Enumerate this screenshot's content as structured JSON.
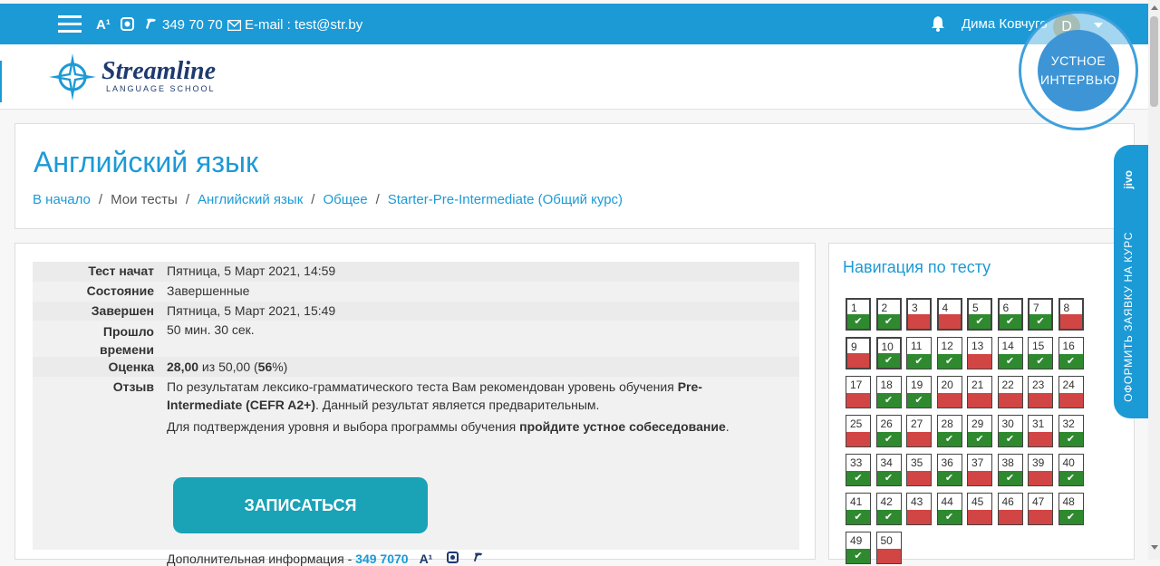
{
  "topbar": {
    "phone": "349 70 70",
    "email": "E-mail : test@str.by",
    "username": "Дима Ковчуго",
    "avatar_letter": "D",
    "icon_a1": "A¹"
  },
  "header": {
    "logo_name": "Streamline",
    "logo_sub": "LANGUAGE SCHOOL",
    "interview_line1": "УСТНОЕ",
    "interview_line2": "ИНТЕРВЬЮ"
  },
  "page": {
    "title": "Английский язык",
    "breadcrumb": [
      "В начало",
      "Мои тесты",
      "Английский язык",
      "Общее",
      "Starter-Pre-Intermediate (Общий курс)"
    ]
  },
  "summary": {
    "started_label": "Тест начат",
    "started_value": "Пятница, 5 Март 2021, 14:59",
    "state_label": "Состояние",
    "state_value": "Завершенные",
    "finished_label": "Завершен",
    "finished_value": "Пятница, 5 Март 2021, 15:49",
    "elapsed_label_1": "Прошло",
    "elapsed_label_2": "времени",
    "elapsed_value": "50 мин. 30 сек.",
    "grade_label": "Оценка",
    "grade_score": "28,00",
    "grade_mid": " из 50,00 (",
    "grade_pct": "56",
    "grade_end": "%)",
    "feedback_label": "Отзыв",
    "feedback_text_1": "По результатам лексико-грамматического теста Вам рекомендован уровень обучения ",
    "feedback_bold": "Pre-Intermediate (CEFR A2+)",
    "feedback_text_2": ". Данный результат является предварительным.",
    "confirm_text": "Для подтверждения уровня и выбора программы обучения ",
    "confirm_bold": "пройдите устное собеседование",
    "confirm_end": ".",
    "enroll_button": "ЗАПИСАТЬСЯ",
    "extra_text": "Дополнительная информация - ",
    "extra_phone": "349 7070"
  },
  "nav": {
    "title": "Навигация по тесту",
    "questions": [
      {
        "n": "1",
        "ok": true,
        "cur": true
      },
      {
        "n": "2",
        "ok": true,
        "cur": true
      },
      {
        "n": "3",
        "ok": false,
        "cur": true
      },
      {
        "n": "4",
        "ok": false,
        "cur": true
      },
      {
        "n": "5",
        "ok": true,
        "cur": true
      },
      {
        "n": "6",
        "ok": true,
        "cur": true
      },
      {
        "n": "7",
        "ok": true,
        "cur": true
      },
      {
        "n": "8",
        "ok": false,
        "cur": true
      },
      {
        "n": "9",
        "ok": false,
        "cur": true
      },
      {
        "n": "10",
        "ok": true,
        "cur": true
      },
      {
        "n": "11",
        "ok": true,
        "cur": false
      },
      {
        "n": "12",
        "ok": true,
        "cur": false
      },
      {
        "n": "13",
        "ok": false,
        "cur": false
      },
      {
        "n": "14",
        "ok": true,
        "cur": false
      },
      {
        "n": "15",
        "ok": true,
        "cur": false
      },
      {
        "n": "16",
        "ok": true,
        "cur": false
      },
      {
        "n": "17",
        "ok": false,
        "cur": false
      },
      {
        "n": "18",
        "ok": true,
        "cur": false
      },
      {
        "n": "19",
        "ok": true,
        "cur": false
      },
      {
        "n": "20",
        "ok": false,
        "cur": false
      },
      {
        "n": "21",
        "ok": false,
        "cur": false
      },
      {
        "n": "22",
        "ok": false,
        "cur": false
      },
      {
        "n": "23",
        "ok": false,
        "cur": false
      },
      {
        "n": "24",
        "ok": false,
        "cur": false
      },
      {
        "n": "25",
        "ok": false,
        "cur": false
      },
      {
        "n": "26",
        "ok": true,
        "cur": false
      },
      {
        "n": "27",
        "ok": false,
        "cur": false
      },
      {
        "n": "28",
        "ok": true,
        "cur": false
      },
      {
        "n": "29",
        "ok": true,
        "cur": false
      },
      {
        "n": "30",
        "ok": true,
        "cur": false
      },
      {
        "n": "31",
        "ok": false,
        "cur": false
      },
      {
        "n": "32",
        "ok": true,
        "cur": false
      },
      {
        "n": "33",
        "ok": true,
        "cur": false
      },
      {
        "n": "34",
        "ok": true,
        "cur": false
      },
      {
        "n": "35",
        "ok": false,
        "cur": false
      },
      {
        "n": "36",
        "ok": true,
        "cur": false
      },
      {
        "n": "37",
        "ok": false,
        "cur": false
      },
      {
        "n": "38",
        "ok": true,
        "cur": false
      },
      {
        "n": "39",
        "ok": false,
        "cur": false
      },
      {
        "n": "40",
        "ok": true,
        "cur": false
      },
      {
        "n": "41",
        "ok": true,
        "cur": false
      },
      {
        "n": "42",
        "ok": true,
        "cur": false
      },
      {
        "n": "43",
        "ok": false,
        "cur": false
      },
      {
        "n": "44",
        "ok": true,
        "cur": false
      },
      {
        "n": "45",
        "ok": false,
        "cur": false
      },
      {
        "n": "46",
        "ok": false,
        "cur": false
      },
      {
        "n": "47",
        "ok": false,
        "cur": false
      },
      {
        "n": "48",
        "ok": true,
        "cur": false
      },
      {
        "n": "49",
        "ok": true,
        "cur": false
      },
      {
        "n": "50",
        "ok": false,
        "cur": false
      }
    ]
  },
  "jivo": {
    "brand": "jivo",
    "cta": "ОФОРМИТЬ ЗАЯВКУ НА КУРС"
  }
}
